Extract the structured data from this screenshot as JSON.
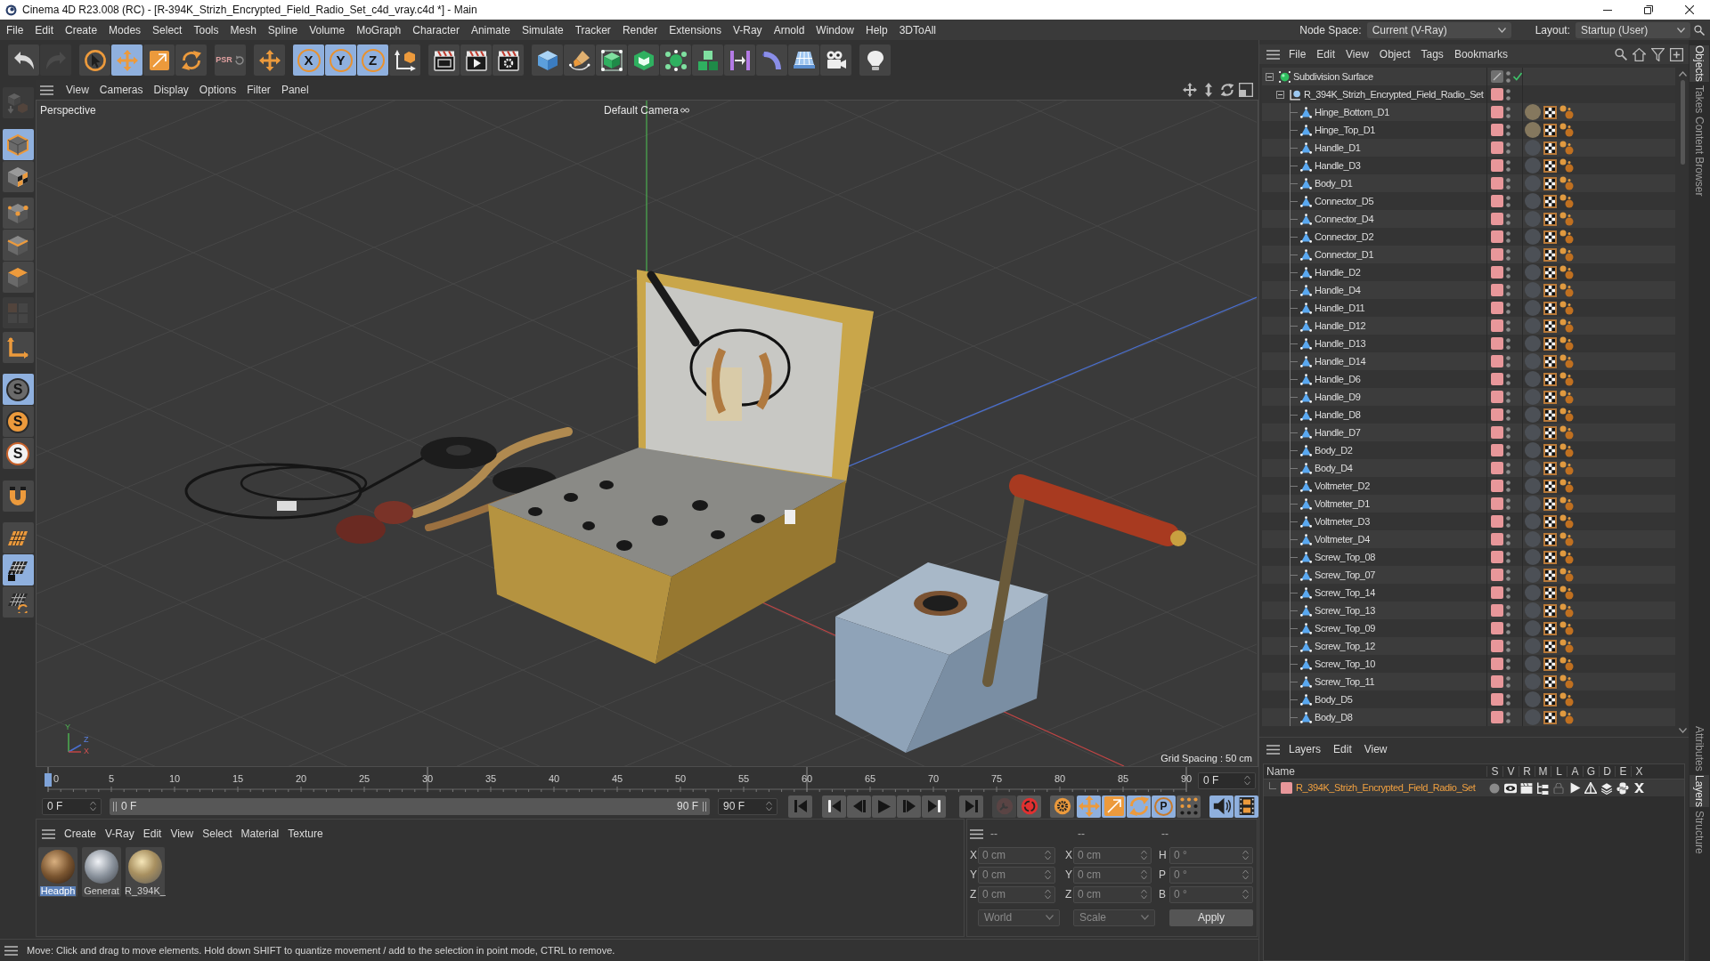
{
  "window": {
    "title": "Cinema 4D R23.008 (RC) - [R-394K_Strizh_Encrypted_Field_Radio_Set_c4d_vray.c4d *] - Main"
  },
  "menu_bar": {
    "items": [
      "File",
      "Edit",
      "Create",
      "Modes",
      "Select",
      "Tools",
      "Mesh",
      "Spline",
      "Volume",
      "MoGraph",
      "Character",
      "Animate",
      "Simulate",
      "Tracker",
      "Render",
      "Extensions",
      "V-Ray",
      "Arnold",
      "Window",
      "Help",
      "3DToAll"
    ],
    "node_space": {
      "label": "Node Space:",
      "value": "Current (V-Ray)"
    },
    "layout": {
      "label": "Layout:",
      "value": "Startup (User)"
    }
  },
  "toolbar": [
    [
      {
        "kind": "undo",
        "on": false,
        "disabled": false
      },
      {
        "kind": "redo",
        "on": false,
        "disabled": true
      }
    ],
    [
      {
        "kind": "select",
        "on": false,
        "disabled": false
      },
      {
        "kind": "move",
        "on": true,
        "disabled": false
      },
      {
        "kind": "scale",
        "on": false,
        "disabled": false
      },
      {
        "kind": "rotate",
        "on": false,
        "disabled": false
      }
    ],
    [
      {
        "kind": "psr",
        "glyph": "PSR",
        "on": false,
        "disabled": true
      }
    ],
    [
      {
        "kind": "transform",
        "on": false,
        "disabled": false
      }
    ],
    [
      {
        "kind": "axis",
        "glyph": "X",
        "on": true,
        "disabled": false
      },
      {
        "kind": "axis",
        "glyph": "Y",
        "on": true,
        "disabled": false
      },
      {
        "kind": "axis",
        "glyph": "Z",
        "on": true,
        "disabled": false
      },
      {
        "kind": "coordinates",
        "on": false,
        "disabled": false
      }
    ],
    [
      {
        "kind": "render-region",
        "on": false,
        "disabled": false
      },
      {
        "kind": "render-view",
        "on": false,
        "disabled": false
      },
      {
        "kind": "render-settings",
        "on": false,
        "disabled": false
      }
    ],
    [
      {
        "kind": "cube",
        "on": false,
        "disabled": false
      },
      {
        "kind": "pen",
        "on": false,
        "disabled": false
      },
      {
        "kind": "subdivision",
        "on": false,
        "disabled": false
      },
      {
        "kind": "extrude",
        "on": false,
        "disabled": false
      },
      {
        "kind": "cloner",
        "on": false,
        "disabled": false
      },
      {
        "kind": "array",
        "on": false,
        "disabled": false
      },
      {
        "kind": "symmetry",
        "on": false,
        "disabled": false
      },
      {
        "kind": "deformer",
        "on": false,
        "disabled": false
      },
      {
        "kind": "floor",
        "on": false,
        "disabled": false
      },
      {
        "kind": "camera",
        "on": false,
        "disabled": false
      }
    ],
    [
      {
        "kind": "light",
        "on": false,
        "disabled": false
      }
    ]
  ],
  "left_toolbar": [
    [
      {
        "kind": "editable",
        "on": false,
        "disabled": true
      }
    ],
    [
      {
        "kind": "model",
        "on": true,
        "disabled": false
      },
      {
        "kind": "texture",
        "on": false,
        "disabled": false
      }
    ],
    [
      {
        "kind": "points",
        "on": false,
        "disabled": false
      },
      {
        "kind": "edges",
        "on": false,
        "disabled": false
      },
      {
        "kind": "polygons",
        "on": false,
        "disabled": false
      }
    ],
    [
      {
        "kind": "uv",
        "on": false,
        "disabled": true
      }
    ],
    [
      {
        "kind": "axis-mode",
        "on": false,
        "disabled": false
      }
    ],
    [
      {
        "kind": "solo-off",
        "glyph": "S",
        "on": true,
        "disabled": false
      },
      {
        "kind": "solo-single",
        "glyph": "S",
        "on": false,
        "disabled": false
      },
      {
        "kind": "solo-hierarchy",
        "glyph": "S",
        "on": false,
        "disabled": false
      }
    ],
    [
      {
        "kind": "snap",
        "on": false,
        "disabled": false
      }
    ],
    [
      {
        "kind": "workplane",
        "on": false,
        "disabled": false
      },
      {
        "kind": "plane-lock",
        "on": true,
        "disabled": false
      },
      {
        "kind": "plane-rotate",
        "on": false,
        "disabled": false
      }
    ]
  ],
  "viewport": {
    "menu": [
      "View",
      "Cameras",
      "Display",
      "Options",
      "Filter",
      "Panel"
    ],
    "camera_view": "Perspective",
    "camera_name": "Default Camera",
    "grid_spacing": "Grid Spacing : 50 cm",
    "axis_labels": [
      "Y",
      "Z",
      "X"
    ]
  },
  "timeline": {
    "ticks": [
      "0",
      "5",
      "10",
      "15",
      "20",
      "25",
      "30",
      "35",
      "40",
      "45",
      "50",
      "55",
      "60",
      "65",
      "70",
      "75",
      "80",
      "85",
      "90"
    ],
    "level": 0,
    "frame_field": "0 F",
    "start_field": "0 F",
    "range": {
      "start": "0 F",
      "end": "90 F",
      "level": 1
    },
    "end_field": "90 F",
    "transport": [
      [
        {
          "kind": "go-start",
          "on": false,
          "disabled": false
        }
      ],
      [
        {
          "kind": "prev-key",
          "on": false,
          "disabled": false
        },
        {
          "kind": "prev-frame",
          "on": false,
          "disabled": false
        },
        {
          "kind": "play",
          "on": false,
          "disabled": false
        },
        {
          "kind": "next-frame",
          "on": false,
          "disabled": false
        },
        {
          "kind": "next-key",
          "on": false,
          "disabled": false
        }
      ],
      [
        {
          "kind": "go-end",
          "on": false,
          "disabled": false
        }
      ],
      [
        {
          "kind": "record",
          "on": false,
          "disabled": true
        },
        {
          "kind": "autokey",
          "on": false,
          "disabled": false
        }
      ],
      [
        {
          "kind": "keyframe-selection",
          "on": false,
          "disabled": false
        }
      ],
      [
        {
          "kind": "position",
          "on": true,
          "disabled": false
        },
        {
          "kind": "scale",
          "on": true,
          "disabled": false
        },
        {
          "kind": "rotate",
          "on": true,
          "disabled": false
        },
        {
          "kind": "parameter",
          "glyph": "P",
          "on": true,
          "disabled": false
        },
        {
          "kind": "point-level",
          "on": false,
          "disabled": false
        }
      ],
      [
        {
          "kind": "sound",
          "on": true,
          "disabled": false
        },
        {
          "kind": "film",
          "on": true,
          "disabled": false
        }
      ]
    ]
  },
  "materials": {
    "menu": [
      "Create",
      "V-Ray",
      "Edit",
      "View",
      "Select",
      "Material",
      "Texture"
    ],
    "items": [
      {
        "name": "Headph",
        "selected": true
      },
      {
        "name": "Generat",
        "selected": false
      },
      {
        "name": "R_394K_",
        "selected": false
      }
    ]
  },
  "coordinates": {
    "disabled": true,
    "headers": [
      "--",
      "--",
      "--"
    ],
    "columns": [
      [
        {
          "label": "X",
          "value": "0 cm"
        },
        {
          "label": "Y",
          "value": "0 cm"
        },
        {
          "label": "Z",
          "value": "0 cm"
        }
      ],
      [
        {
          "label": "X",
          "value": "0 cm"
        },
        {
          "label": "Y",
          "value": "0 cm"
        },
        {
          "label": "Z",
          "value": "0 cm"
        }
      ],
      [
        {
          "label": "H",
          "value": "0 °"
        },
        {
          "label": "P",
          "value": "0 °"
        },
        {
          "label": "B",
          "value": "0 °"
        }
      ]
    ],
    "dropdowns": [
      "World",
      "Scale"
    ],
    "apply": "Apply"
  },
  "status_bar": {
    "text": "Move: Click and drag to move elements. Hold down SHIFT to quantize movement / add to the selection in point mode, CTRL to remove."
  },
  "objects": {
    "menu": [
      "File",
      "Edit",
      "View",
      "Object",
      "Tags",
      "Bookmarks"
    ],
    "items": [
      {
        "name": "Subdivision Surface",
        "kind": "subdivision",
        "in_layer": false,
        "enabled": true,
        "expanded": true,
        "children": [
          {
            "name": "R_394K_Strizh_Encrypted_Field_Radio_Set",
            "kind": "null",
            "in_layer": true,
            "expanded": true,
            "children": [
              {
                "name": "Hinge_Bottom_D1",
                "kind": "polygon",
                "in_layer": true,
                "color": "#85785e"
              },
              {
                "name": "Hinge_Top_D1",
                "kind": "polygon",
                "in_layer": true,
                "color": "#85785e"
              },
              {
                "name": "Handle_D1",
                "kind": "polygon",
                "in_layer": true,
                "color": "#4c5056"
              },
              {
                "name": "Handle_D3",
                "kind": "polygon",
                "in_layer": true,
                "color": "#4c5056"
              },
              {
                "name": "Body_D1",
                "kind": "polygon",
                "in_layer": true,
                "color": "#4c5056"
              },
              {
                "name": "Connector_D5",
                "kind": "polygon",
                "in_layer": true,
                "color": "#4c5056"
              },
              {
                "name": "Connector_D4",
                "kind": "polygon",
                "in_layer": true,
                "color": "#4c5056"
              },
              {
                "name": "Connector_D2",
                "kind": "polygon",
                "in_layer": true,
                "color": "#4c5056"
              },
              {
                "name": "Connector_D1",
                "kind": "polygon",
                "in_layer": true,
                "color": "#4c5056"
              },
              {
                "name": "Handle_D2",
                "kind": "polygon",
                "in_layer": true,
                "color": "#4c5056"
              },
              {
                "name": "Handle_D4",
                "kind": "polygon",
                "in_layer": true,
                "color": "#4c5056"
              },
              {
                "name": "Handle_D11",
                "kind": "polygon",
                "in_layer": true,
                "color": "#4c5056"
              },
              {
                "name": "Handle_D12",
                "kind": "polygon",
                "in_layer": true,
                "color": "#4c5056"
              },
              {
                "name": "Handle_D13",
                "kind": "polygon",
                "in_layer": true,
                "color": "#4c5056"
              },
              {
                "name": "Handle_D14",
                "kind": "polygon",
                "in_layer": true,
                "color": "#4c5056"
              },
              {
                "name": "Handle_D6",
                "kind": "polygon",
                "in_layer": true,
                "color": "#4c5056"
              },
              {
                "name": "Handle_D9",
                "kind": "polygon",
                "in_layer": true,
                "color": "#4c5056"
              },
              {
                "name": "Handle_D8",
                "kind": "polygon",
                "in_layer": true,
                "color": "#4c5056"
              },
              {
                "name": "Handle_D7",
                "kind": "polygon",
                "in_layer": true,
                "color": "#4c5056"
              },
              {
                "name": "Body_D2",
                "kind": "polygon",
                "in_layer": true,
                "color": "#4c5056"
              },
              {
                "name": "Body_D4",
                "kind": "polygon",
                "in_layer": true,
                "color": "#4c5056"
              },
              {
                "name": "Voltmeter_D2",
                "kind": "polygon",
                "in_layer": true,
                "color": "#4c5056"
              },
              {
                "name": "Voltmeter_D1",
                "kind": "polygon",
                "in_layer": true,
                "color": "#4c5056"
              },
              {
                "name": "Voltmeter_D3",
                "kind": "polygon",
                "in_layer": true,
                "color": "#4c5056"
              },
              {
                "name": "Voltmeter_D4",
                "kind": "polygon",
                "in_layer": true,
                "color": "#4c5056"
              },
              {
                "name": "Screw_Top_08",
                "kind": "polygon",
                "in_layer": true,
                "color": "#4c5056"
              },
              {
                "name": "Screw_Top_07",
                "kind": "polygon",
                "in_layer": true,
                "color": "#4c5056"
              },
              {
                "name": "Screw_Top_14",
                "kind": "polygon",
                "in_layer": true,
                "color": "#4c5056"
              },
              {
                "name": "Screw_Top_13",
                "kind": "polygon",
                "in_layer": true,
                "color": "#4c5056"
              },
              {
                "name": "Screw_Top_09",
                "kind": "polygon",
                "in_layer": true,
                "color": "#4c5056"
              },
              {
                "name": "Screw_Top_12",
                "kind": "polygon",
                "in_layer": true,
                "color": "#4c5056"
              },
              {
                "name": "Screw_Top_10",
                "kind": "polygon",
                "in_layer": true,
                "color": "#4c5056"
              },
              {
                "name": "Screw_Top_11",
                "kind": "polygon",
                "in_layer": true,
                "color": "#4c5056"
              },
              {
                "name": "Body_D5",
                "kind": "polygon",
                "in_layer": true,
                "color": "#4c5056"
              },
              {
                "name": "Body_D8",
                "kind": "polygon",
                "in_layer": true,
                "color": "#4c5056"
              }
            ]
          }
        ]
      }
    ]
  },
  "layers": {
    "menu": [
      "Layers",
      "Edit",
      "View"
    ],
    "columns": [
      "Name",
      "S",
      "V",
      "R",
      "M",
      "L",
      "A",
      "G",
      "D",
      "E",
      "X"
    ],
    "rows": [
      {
        "name": "R_394K_Strizh_Encrypted_Field_Radio_Set",
        "color": "#e8979a",
        "flags": [
          {
            "kind": "solo",
            "on": false
          },
          {
            "kind": "visible",
            "on": true
          },
          {
            "kind": "render",
            "on": true
          },
          {
            "kind": "manager",
            "on": true
          },
          {
            "kind": "locked",
            "on": false
          },
          {
            "kind": "animation",
            "on": true
          },
          {
            "kind": "generators",
            "on": true
          },
          {
            "kind": "deformers",
            "on": true
          },
          {
            "kind": "expressions",
            "on": true
          },
          {
            "kind": "xrefs",
            "on": true
          }
        ]
      }
    ]
  },
  "side_tabs": {
    "top": [
      {
        "label": "Objects",
        "selected": true
      },
      {
        "label": "Takes",
        "selected": false
      },
      {
        "label": "Content Browser",
        "selected": false
      }
    ],
    "bottom": [
      {
        "label": "Attributes",
        "selected": false
      },
      {
        "label": "Layers",
        "selected": true
      },
      {
        "label": "Structure",
        "selected": false
      }
    ]
  }
}
